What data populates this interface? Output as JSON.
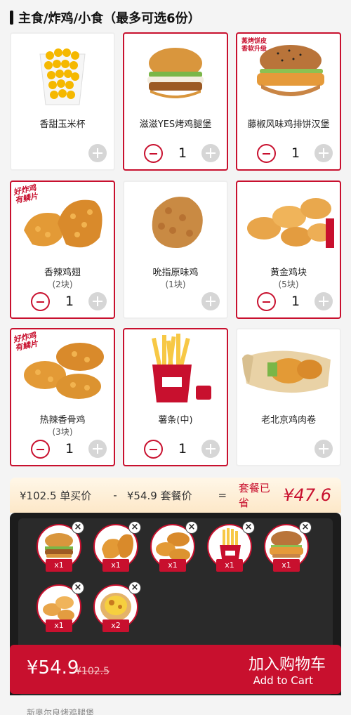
{
  "section": {
    "title": "主食/炸鸡/小食（最多可选6份）"
  },
  "products": [
    {
      "name": "香甜玉米杯",
      "sub": "",
      "qty": "",
      "selected": false,
      "icon": "corn-cup-icon"
    },
    {
      "name": "滋滋YES烤鸡腿堡",
      "sub": "",
      "qty": "1",
      "selected": true,
      "icon": "burger-icon"
    },
    {
      "name": "藤椒风味鸡排饼汉堡",
      "sub": "",
      "qty": "1",
      "selected": true,
      "icon": "burger-icon",
      "tag": "蒸烤饼皮\n香软升级"
    },
    {
      "name": "香辣鸡翅",
      "sub": "(2块)",
      "qty": "1",
      "selected": true,
      "icon": "chicken-wing-icon",
      "tag": "好炸鸡\n有鳞片"
    },
    {
      "name": "吮指原味鸡",
      "sub": "(1块)",
      "qty": "",
      "selected": false,
      "icon": "fried-chicken-icon"
    },
    {
      "name": "黄金鸡块",
      "sub": "(5块)",
      "qty": "1",
      "selected": true,
      "icon": "nuggets-icon"
    },
    {
      "name": "热辣香骨鸡",
      "sub": "(3块)",
      "qty": "1",
      "selected": true,
      "icon": "chicken-wing-icon",
      "tag": "好炸鸡\n有鳞片"
    },
    {
      "name": "薯条(中)",
      "sub": "",
      "qty": "1",
      "selected": true,
      "icon": "fries-icon"
    },
    {
      "name": "老北京鸡肉卷",
      "sub": "",
      "qty": "",
      "selected": false,
      "icon": "wrap-icon"
    }
  ],
  "summary": {
    "original": "¥102.5 单买价",
    "minus": "-",
    "package": "¥54.9 套餐价",
    "equals": "=",
    "save_label": "套餐已省",
    "save_amount": "¥47.6"
  },
  "cart": {
    "items": [
      {
        "qty": "x1",
        "icon": "burger-icon"
      },
      {
        "qty": "x1",
        "icon": "chicken-wing-icon"
      },
      {
        "qty": "x1",
        "icon": "chicken-wing-icon"
      },
      {
        "qty": "x1",
        "icon": "fries-icon"
      },
      {
        "qty": "x1",
        "icon": "burger-icon"
      },
      {
        "qty": "x1",
        "icon": "nuggets-icon"
      },
      {
        "qty": "x2",
        "icon": "egg-tart-icon"
      }
    ],
    "remove_symbol": "×"
  },
  "footer": {
    "price": "¥54.9",
    "original_price": "¥102.5",
    "add_cn": "加入购物车",
    "add_en": "Add to Cart"
  },
  "below_text": "新奥尔良烤鸡腿堡",
  "colors": {
    "brand": "#c8102e",
    "dark": "#1c1c1c",
    "summary_bg": "#fde8c8"
  }
}
